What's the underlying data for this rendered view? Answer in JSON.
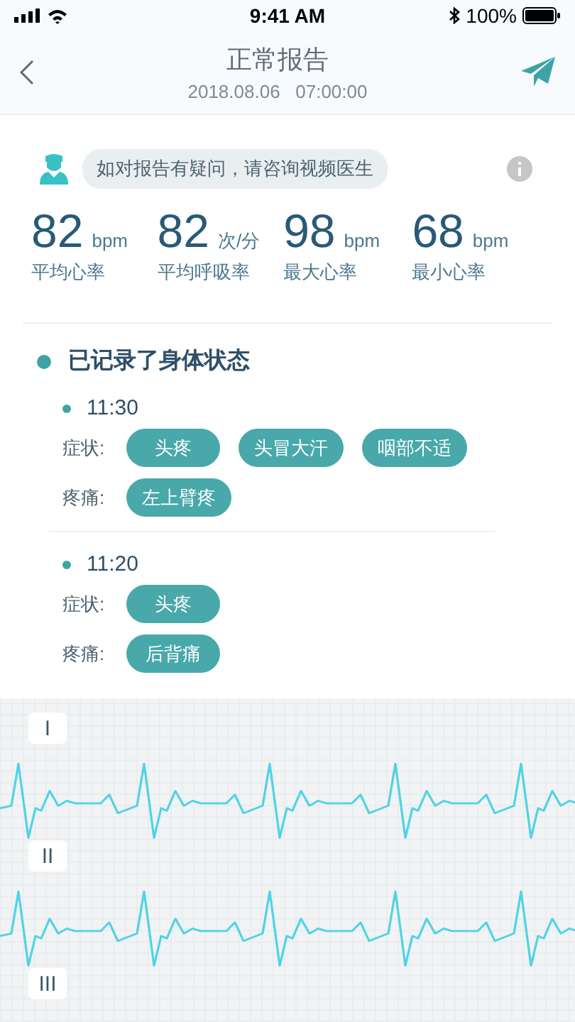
{
  "status_bar": {
    "time": "9:41 AM",
    "battery": "100%"
  },
  "nav": {
    "title": "正常报告",
    "subtitle": "2018.08.06   07:00:00"
  },
  "notice": {
    "text": "如对报告有疑问，请咨询视频医生"
  },
  "stats": [
    {
      "value": "82",
      "unit": "bpm",
      "label": "平均心率"
    },
    {
      "value": "82",
      "unit": "次/分",
      "label": "平均呼吸率"
    },
    {
      "value": "98",
      "unit": "bpm",
      "label": "最大心率"
    },
    {
      "value": "68",
      "unit": "bpm",
      "label": "最小心率"
    }
  ],
  "records": {
    "title": "已记录了身体状态",
    "entries": [
      {
        "time": "11:30",
        "groups": [
          {
            "label": "症状:",
            "tags": [
              "头疼",
              "头冒大汗",
              "咽部不适"
            ]
          },
          {
            "label": "疼痛:",
            "tags": [
              "左上臂疼"
            ]
          }
        ]
      },
      {
        "time": "11:20",
        "groups": [
          {
            "label": "症状:",
            "tags": [
              "头疼"
            ]
          },
          {
            "label": "疼痛:",
            "tags": [
              "后背痛"
            ]
          }
        ]
      }
    ]
  },
  "ecg": {
    "leads": [
      {
        "label": "I"
      },
      {
        "label": "II"
      },
      {
        "label": "III"
      }
    ]
  }
}
